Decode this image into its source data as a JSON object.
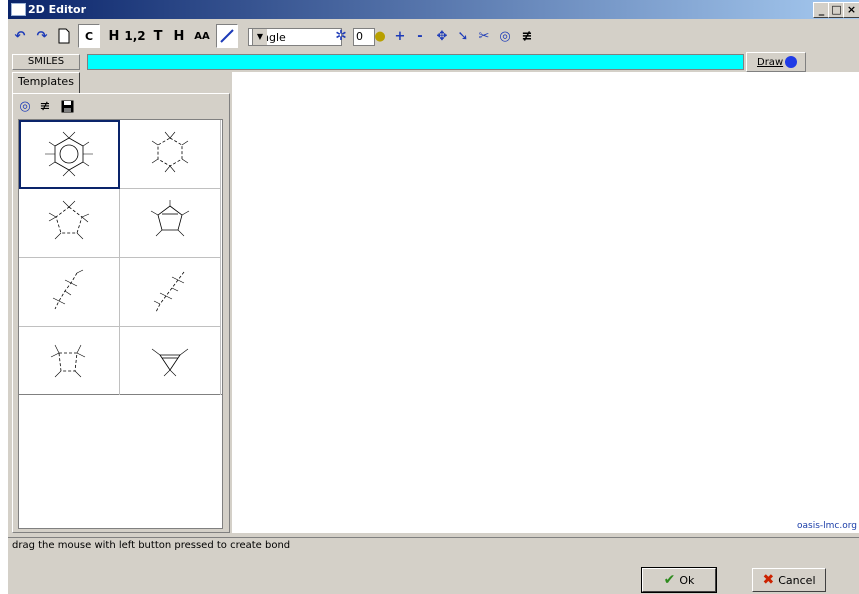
{
  "window": {
    "title": "2D Editor",
    "controls": [
      "_",
      "□",
      "×"
    ]
  },
  "toolbar": {
    "carbon_label": "C",
    "hydrogen_label": "H",
    "numbering_label": "1,2",
    "text_label": "T",
    "h_label": "H",
    "aa_label": "AA",
    "bond_type": "Single",
    "charge_value": "0",
    "plus_label": "+",
    "minus_label": "-"
  },
  "smiles": {
    "label": "SMILES",
    "value": "",
    "draw_label": "Draw"
  },
  "templates": {
    "tab_label": "Templates",
    "items": [
      "benzene",
      "cyclohexane",
      "cyclopentane",
      "cyclopentene",
      "chain-1",
      "chain-2",
      "cyclobutane",
      "cyclopropene"
    ]
  },
  "canvas": {
    "watermark": "oasis-lmc.org"
  },
  "status": {
    "message": "drag the mouse with left button pressed to create bond"
  },
  "buttons": {
    "ok_label": "Ok",
    "cancel_label": "Cancel"
  },
  "colors": {
    "accent": "#0a246a",
    "smiles_bg": "#00ffff",
    "ok_check": "#2e8b1e",
    "cancel_x": "#cc2200"
  }
}
